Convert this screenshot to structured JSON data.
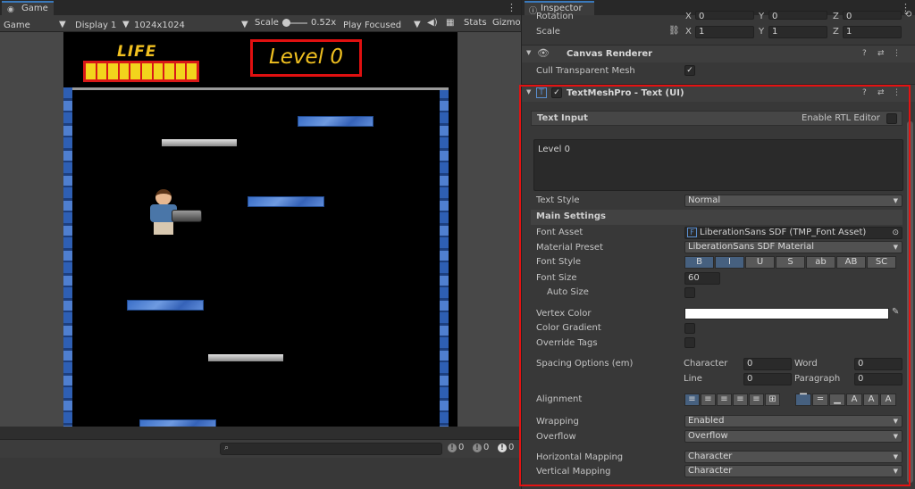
{
  "game": {
    "tab_label": "Game",
    "mode_dropdown": "Game",
    "display_dropdown": "Display 1",
    "resolution_dropdown": "1024x1024",
    "scale_label": "Scale",
    "scale_value": "0.52x",
    "play_mode_dropdown": "Play Focused",
    "stats_label": "Stats",
    "gizmos_label": "Gizmo",
    "hud": {
      "life_label": "LIFE",
      "level_text": "Level 0",
      "life_segments": 10
    }
  },
  "console": {
    "search_placeholder": "",
    "log_count": "0",
    "warning_count": "0",
    "error_count": "0"
  },
  "inspector": {
    "tab_label": "Inspector",
    "rotation_label": "Rotation",
    "rotation": {
      "x": "0",
      "y": "0",
      "z": "0"
    },
    "scale_label": "Scale",
    "scale": {
      "x": "1",
      "y": "1",
      "z": "1"
    },
    "axis_labels": {
      "x": "X",
      "y": "Y",
      "z": "Z"
    },
    "canvas_renderer_title": "Canvas Renderer",
    "cull_label": "Cull Transparent Mesh",
    "tmp_title": "TextMeshPro - Text (UI)",
    "text_input_label": "Text Input",
    "rtl_label": "Enable RTL Editor",
    "text_value": "Level 0",
    "text_style_label": "Text Style",
    "text_style_value": "Normal",
    "main_settings_label": "Main Settings",
    "font_asset_label": "Font Asset",
    "font_asset_value": "LiberationSans SDF (TMP_Font Asset)",
    "material_preset_label": "Material Preset",
    "material_preset_value": "LiberationSans SDF Material",
    "font_style_label": "Font Style",
    "font_style_buttons": [
      "B",
      "I",
      "U",
      "S",
      "ab",
      "AB",
      "SC"
    ],
    "font_size_label": "Font Size",
    "font_size_value": "60",
    "auto_size_label": "Auto Size",
    "vertex_color_label": "Vertex Color",
    "vertex_color_value": "#ffffff",
    "color_gradient_label": "Color Gradient",
    "override_tags_label": "Override Tags",
    "spacing_label": "Spacing Options (em)",
    "character_label": "Character",
    "character_value": "0",
    "word_label": "Word",
    "word_value": "0",
    "line_label": "Line",
    "line_value": "0",
    "paragraph_label": "Paragraph",
    "paragraph_value": "0",
    "alignment_label": "Alignment",
    "wrapping_label": "Wrapping",
    "wrapping_value": "Enabled",
    "overflow_label": "Overflow",
    "overflow_value": "Overflow",
    "horizontal_mapping_label": "Horizontal Mapping",
    "horizontal_mapping_value": "Character",
    "vertical_mapping_label": "Vertical Mapping",
    "vertical_mapping_value": "Character"
  },
  "colors": {
    "highlight_outline": "#e41212",
    "accent_tab": "#3a79bb",
    "game_hud_text": "#f0c020"
  }
}
